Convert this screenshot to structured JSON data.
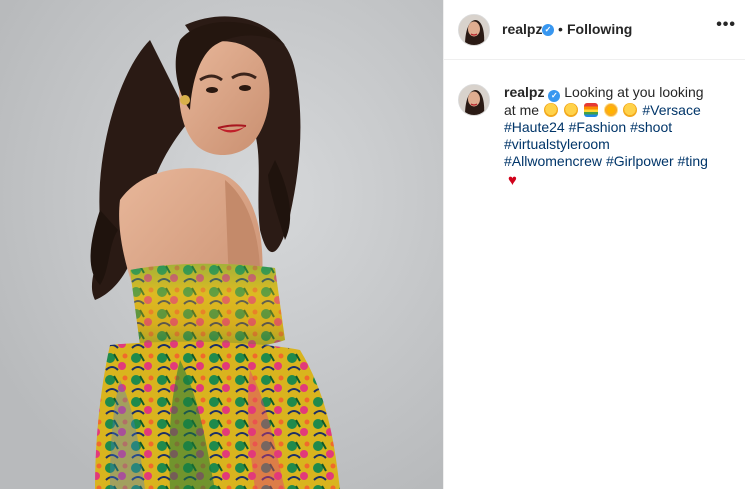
{
  "header": {
    "username": "realpz",
    "separator": "•",
    "follow_status": "Following",
    "more_label": "•••"
  },
  "caption": {
    "username": "realpz",
    "text_before": "Looking at you looking at me",
    "hashtags": [
      "#Versace",
      "#Haute24",
      "#Fashion",
      "#shoot",
      "#virtualstyleroom",
      "#Allwomencrew",
      "#Girlpower",
      "#ting"
    ],
    "heart": "♥"
  },
  "icons": {
    "verified": "verified-badge-icon",
    "more": "more-options-icon"
  },
  "colors": {
    "verified": "#3897f0",
    "hashtag": "#003569",
    "text": "#262626",
    "heart": "#d0021b"
  }
}
